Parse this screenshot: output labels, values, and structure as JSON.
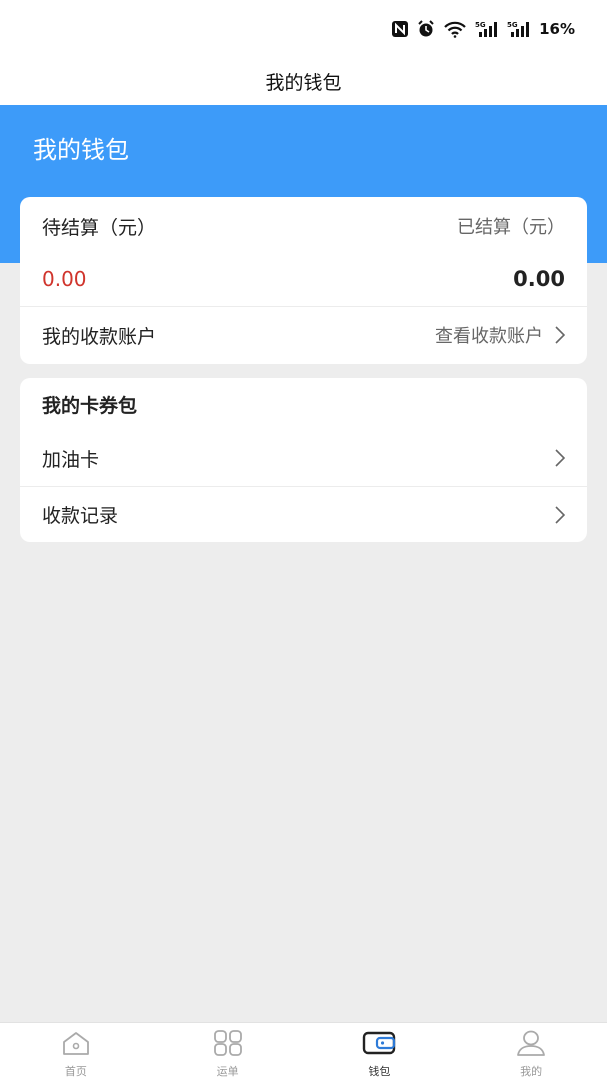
{
  "status_bar": {
    "battery": "16%"
  },
  "nav": {
    "title": "我的钱包"
  },
  "banner": {
    "title": "我的钱包"
  },
  "balance": {
    "pending_label": "待结算（元）",
    "settled_label": "已结算（元）",
    "pending_value": "0.00",
    "settled_value": "0.00",
    "account_label": "我的收款账户",
    "account_link": "查看收款账户"
  },
  "wallet": {
    "title": "我的卡券包",
    "items": [
      {
        "label": "加油卡"
      },
      {
        "label": "收款记录"
      }
    ]
  },
  "tabs": [
    {
      "label": "首页",
      "icon": "home-icon"
    },
    {
      "label": "运单",
      "icon": "grid-icon"
    },
    {
      "label": "钱包",
      "icon": "wallet-icon"
    },
    {
      "label": "我的",
      "icon": "user-icon"
    }
  ],
  "colors": {
    "accent": "#3d9bf9",
    "pending": "#d0342c"
  }
}
